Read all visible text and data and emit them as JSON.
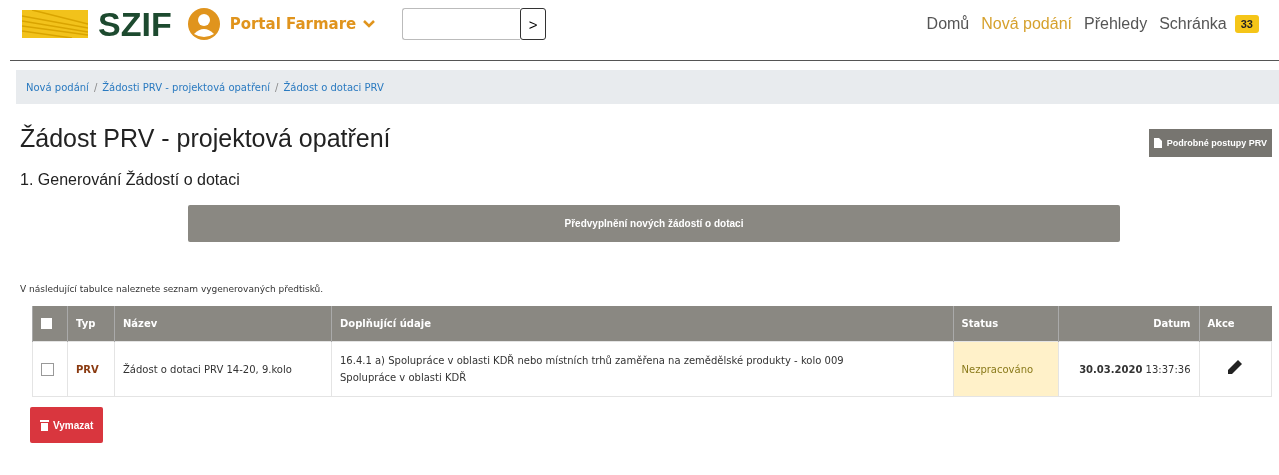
{
  "header": {
    "logo_text": "SZIF",
    "portal": "Portal Farmare",
    "search": {
      "button": ">"
    },
    "nav": [
      {
        "label": "Domů",
        "selected": false
      },
      {
        "label": "Nová podání",
        "selected": true
      },
      {
        "label": "Přehledy",
        "selected": false
      },
      {
        "label": "Schránka",
        "selected": false,
        "badge": "33"
      }
    ]
  },
  "breadcrumb_separator": "/",
  "breadcrumb": [
    "Nová podání",
    "Žádosti PRV - projektová opatření",
    "Žádost o dotaci PRV"
  ],
  "title": "Žádost PRV - projektová opatření",
  "guide_button": "Podrobné postupy PRV",
  "section_title": "1. Generování Žádostí o dotaci",
  "prefill_button": "Předvyplnění nových žádostí o dotaci",
  "table_intro": "V následující tabulce naleznete seznam vygenerovaných předtisků.",
  "table": {
    "select_all_checked": false,
    "columns": [
      "Typ",
      "Název",
      "Doplňující údaje",
      "Status",
      "Datum",
      "Akce"
    ],
    "rows": [
      {
        "checked": false,
        "type": "PRV",
        "name": "Žádost o dotaci PRV 14-20, 9.kolo",
        "details": [
          "16.4.1 a) Spolupráce v oblasti KDŘ nebo místních trhů zaměřena na zemědělské produkty - kolo 009",
          "Spolupráce v oblasti KDŘ"
        ],
        "status": "Nezpracováno",
        "date": "**30.03.2020** 13:37:36"
      }
    ]
  },
  "delete_button": "Vymazat"
}
